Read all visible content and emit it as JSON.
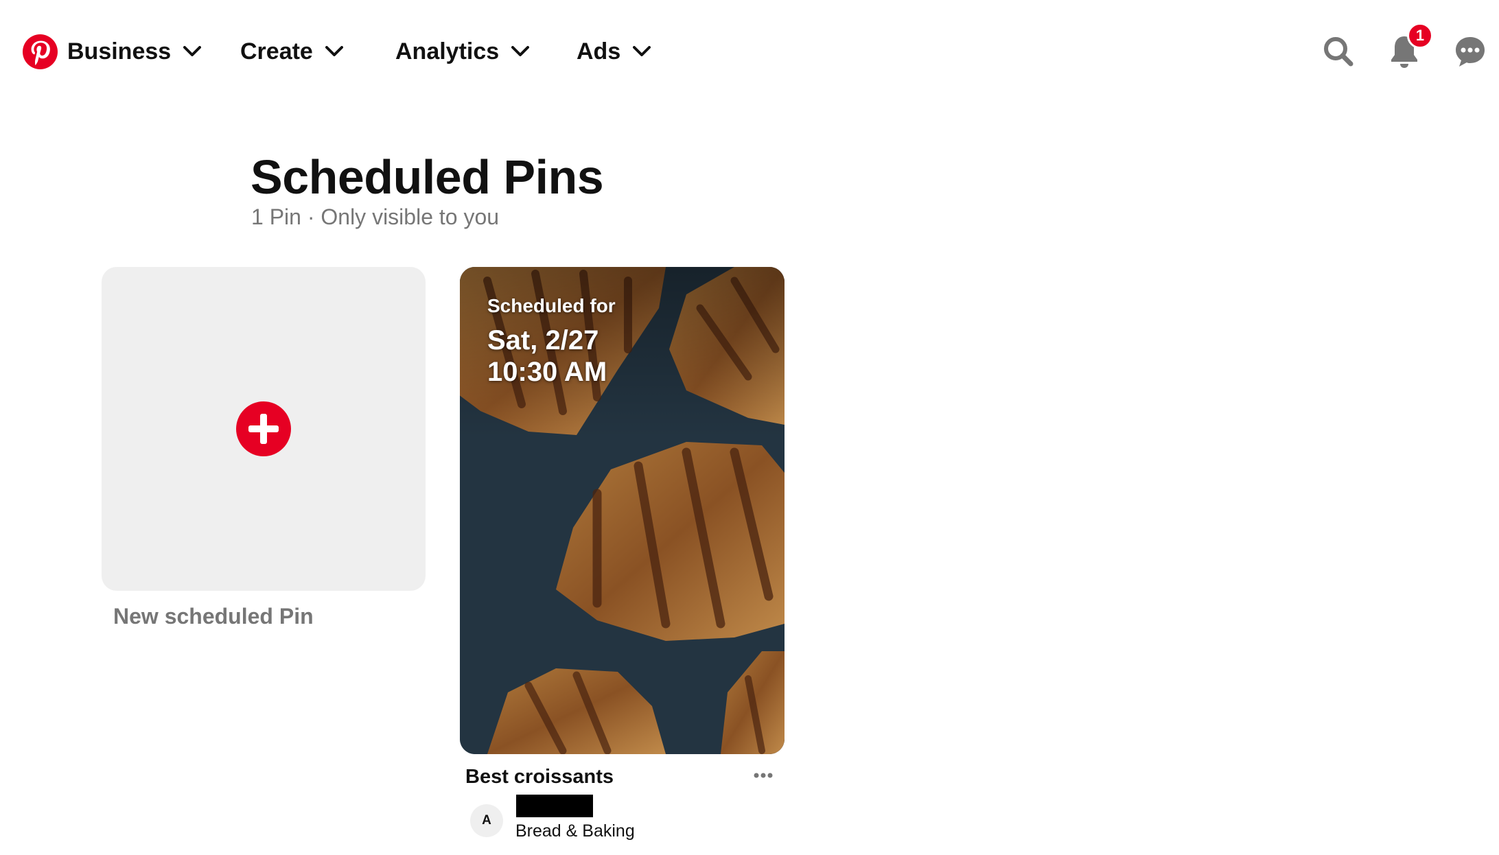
{
  "colors": {
    "brand_red": "#e60023",
    "text_primary": "#111111",
    "text_secondary": "#767676",
    "card_background": "#efefef",
    "icon_gray": "#767676"
  },
  "nav": {
    "logo_icon": "pinterest-logo-icon",
    "items": [
      {
        "label": "Business",
        "icon": "chevron-down-icon"
      },
      {
        "label": "Create",
        "icon": "chevron-down-icon"
      },
      {
        "label": "Analytics",
        "icon": "chevron-down-icon"
      },
      {
        "label": "Ads",
        "icon": "chevron-down-icon"
      }
    ],
    "search_icon": "search-icon",
    "notifications_icon": "bell-icon",
    "notifications_count": "1",
    "messages_icon": "speech-bubble-icon"
  },
  "page": {
    "title": "Scheduled Pins",
    "subtitle": "1 Pin · Only visible to you"
  },
  "new_pin": {
    "icon": "plus-circle-icon",
    "label": "New scheduled Pin"
  },
  "pins": [
    {
      "scheduled_label": "Scheduled for",
      "date": "Sat, 2/27",
      "time": "10:30 AM",
      "image_description_icon": "croissants-photo",
      "title": "Best croissants",
      "more_icon": "ellipsis-icon",
      "avatar_initial": "A",
      "board": "Bread & Baking"
    }
  ]
}
